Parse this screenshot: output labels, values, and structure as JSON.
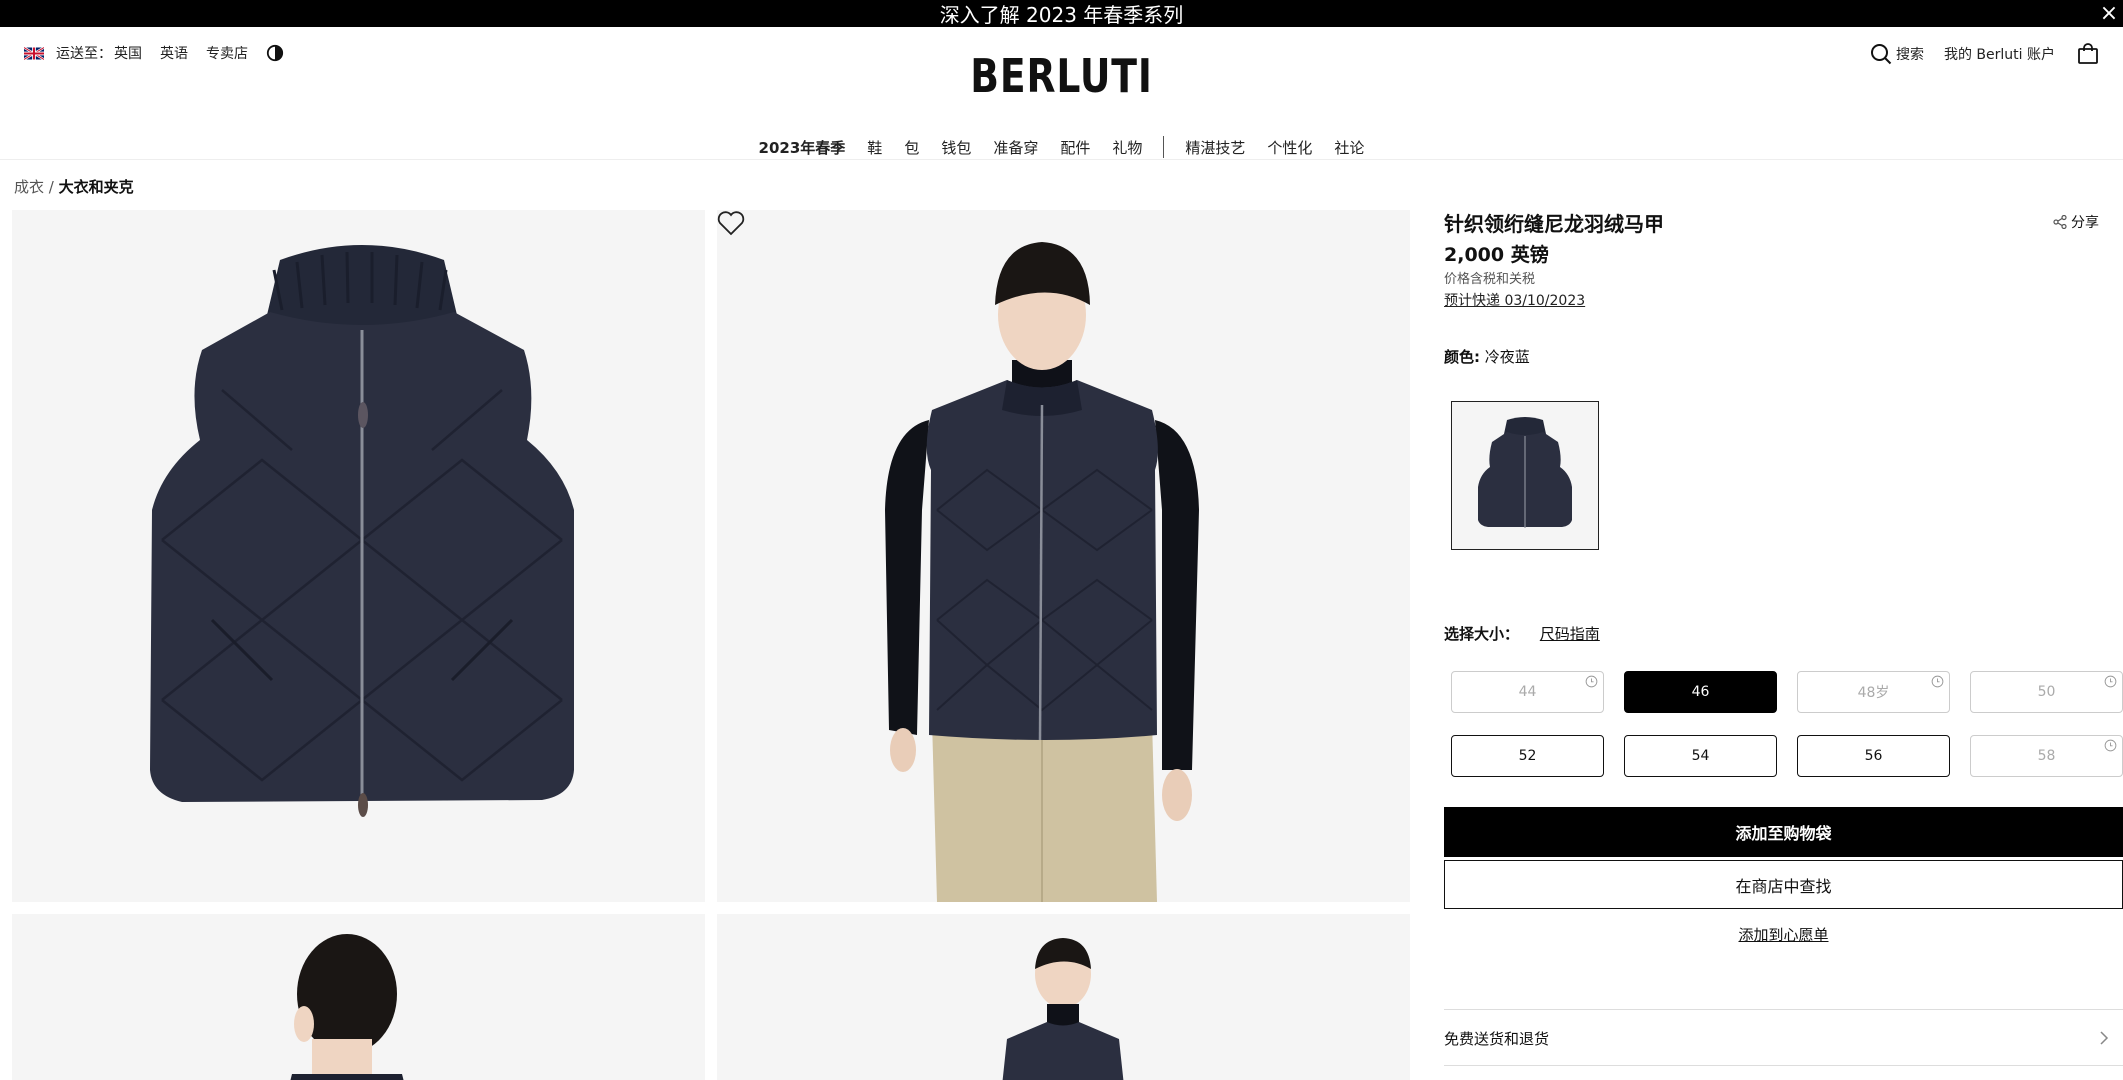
{
  "promo": {
    "text": "深入了解 2023 年春季系列",
    "close_icon": "×"
  },
  "header": {
    "ship_to_label": "运送至：",
    "ship_to_country": "英国",
    "language": "英语",
    "stores": "专卖店",
    "logo": "BERLUTI",
    "search_label": "搜索",
    "account_label": "我的 Berluti 账户",
    "icons": [
      "uk-flag-icon",
      "contrast-icon",
      "search-icon",
      "shopping-bag-icon"
    ]
  },
  "nav": {
    "items": [
      "2023年春季",
      "鞋",
      "包",
      "钱包",
      "准备穿",
      "配件",
      "礼物"
    ],
    "items_right": [
      "精湛技艺",
      "个性化",
      "社论"
    ]
  },
  "breadcrumb": {
    "parent": "成衣 /",
    "current": "大衣和夹克"
  },
  "product": {
    "title": "针织领绗缝尼龙羽绒马甲",
    "share_label": "分享",
    "price": "2,000 英镑",
    "tax_note": "价格含税和关税",
    "delivery": "预计快递 03/10/2023",
    "color_label": "颜色:",
    "color_value": "冷夜蓝",
    "size_label": "选择大小：",
    "size_guide": "尺码指南",
    "sizes": [
      {
        "label": "44",
        "state": "unavailable"
      },
      {
        "label": "46",
        "state": "selected"
      },
      {
        "label": "48岁",
        "state": "unavailable"
      },
      {
        "label": "50",
        "state": "unavailable"
      },
      {
        "label": "52",
        "state": "available"
      },
      {
        "label": "54",
        "state": "available"
      },
      {
        "label": "56",
        "state": "available"
      },
      {
        "label": "58",
        "state": "unavailable"
      }
    ],
    "add_to_bag": "添加至购物袋",
    "find_in_store": "在商店中查找",
    "add_to_wishlist": "添加到心愿单",
    "shipping_returns": "免费送货和退货"
  },
  "colors": {
    "accent": "#000000",
    "background": "#ffffff",
    "image_bg": "#f5f5f5",
    "garment": "#2b2f40"
  }
}
